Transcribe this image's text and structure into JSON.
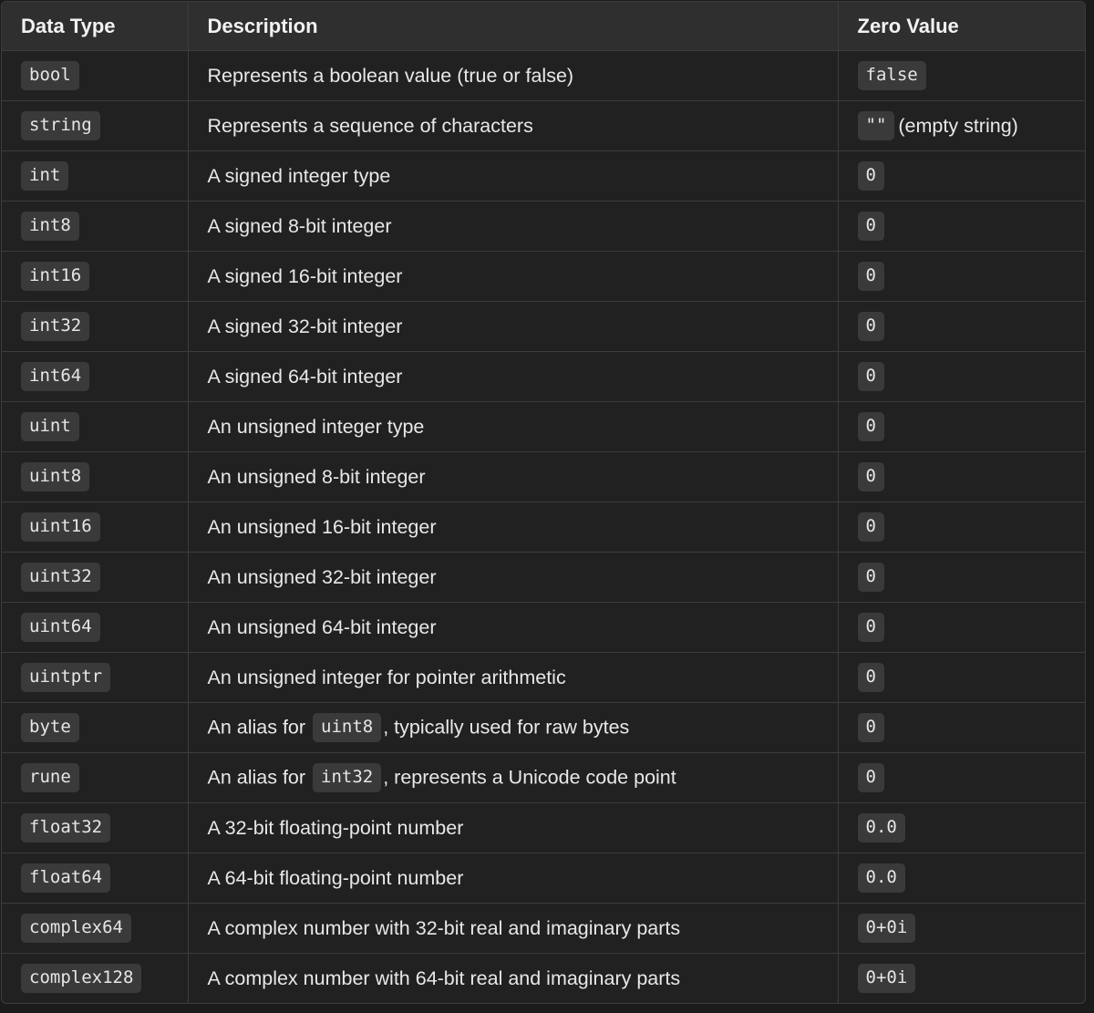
{
  "headers": [
    "Data Type",
    "Description",
    "Zero Value"
  ],
  "rows": [
    {
      "type": "bool",
      "desc": [
        {
          "t": "Represents a boolean value (true or false)"
        }
      ],
      "zero": "false"
    },
    {
      "type": "string",
      "desc": [
        {
          "t": "Represents a sequence of characters"
        }
      ],
      "zero": "\"\"",
      "zero_suffix": "(empty string)"
    },
    {
      "type": "int",
      "desc": [
        {
          "t": "A signed integer type"
        }
      ],
      "zero": "0"
    },
    {
      "type": "int8",
      "desc": [
        {
          "t": "A signed 8-bit integer"
        }
      ],
      "zero": "0"
    },
    {
      "type": "int16",
      "desc": [
        {
          "t": "A signed 16-bit integer"
        }
      ],
      "zero": "0"
    },
    {
      "type": "int32",
      "desc": [
        {
          "t": "A signed 32-bit integer"
        }
      ],
      "zero": "0"
    },
    {
      "type": "int64",
      "desc": [
        {
          "t": "A signed 64-bit integer"
        }
      ],
      "zero": "0"
    },
    {
      "type": "uint",
      "desc": [
        {
          "t": "An unsigned integer type"
        }
      ],
      "zero": "0"
    },
    {
      "type": "uint8",
      "desc": [
        {
          "t": "An unsigned 8-bit integer"
        }
      ],
      "zero": "0"
    },
    {
      "type": "uint16",
      "desc": [
        {
          "t": "An unsigned 16-bit integer"
        }
      ],
      "zero": "0"
    },
    {
      "type": "uint32",
      "desc": [
        {
          "t": "An unsigned 32-bit integer"
        }
      ],
      "zero": "0"
    },
    {
      "type": "uint64",
      "desc": [
        {
          "t": "An unsigned 64-bit integer"
        }
      ],
      "zero": "0"
    },
    {
      "type": "uintptr",
      "desc": [
        {
          "t": "An unsigned integer for pointer arithmetic"
        }
      ],
      "zero": "0"
    },
    {
      "type": "byte",
      "desc": [
        {
          "t": "An alias for "
        },
        {
          "c": "uint8"
        },
        {
          "t": ", typically used for raw bytes"
        }
      ],
      "zero": "0"
    },
    {
      "type": "rune",
      "desc": [
        {
          "t": "An alias for "
        },
        {
          "c": "int32"
        },
        {
          "t": ", represents a Unicode code point"
        }
      ],
      "zero": "0"
    },
    {
      "type": "float32",
      "desc": [
        {
          "t": "A 32-bit floating-point number"
        }
      ],
      "zero": "0.0"
    },
    {
      "type": "float64",
      "desc": [
        {
          "t": "A 64-bit floating-point number"
        }
      ],
      "zero": "0.0"
    },
    {
      "type": "complex64",
      "desc": [
        {
          "t": "A complex number with 32-bit real and imaginary parts"
        }
      ],
      "zero": "0+0i"
    },
    {
      "type": "complex128",
      "desc": [
        {
          "t": "A complex number with 64-bit real and imaginary parts"
        }
      ],
      "zero": "0+0i"
    }
  ]
}
